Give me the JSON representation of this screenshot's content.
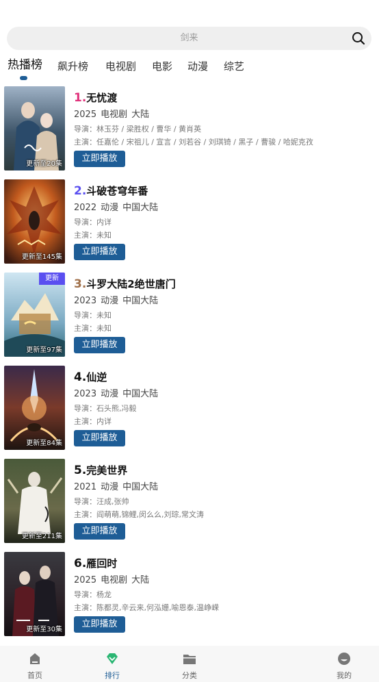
{
  "search": {
    "placeholder": "剑来"
  },
  "tabs": [
    {
      "label": "热播榜",
      "active": true
    },
    {
      "label": "飙升榜"
    },
    {
      "label": "电视剧"
    },
    {
      "label": "电影"
    },
    {
      "label": "动漫"
    },
    {
      "label": "综艺"
    }
  ],
  "colors": {
    "accent": "#1e5d96",
    "rank1": "#e0307a",
    "rank2": "#5a4ff0",
    "rank3": "#a0704a",
    "rankOther": "#111111",
    "newBadge": "#5a4ff0"
  },
  "items": [
    {
      "rank": "1.",
      "title": "无忧渡",
      "year": "2025",
      "type": "电视剧",
      "region": "大陆",
      "director": "导演：林玉芬 / 梁胜权 / 曹华 / 黄肖英",
      "cast": "主演：任嘉伦 / 宋祖儿 / 宣言 / 刘若谷 / 刘琪锜 / 黑子 / 曹骏 / 哈妮克孜",
      "badge": "更新至20集",
      "play": "立即播放"
    },
    {
      "rank": "2.",
      "title": "斗破苍穹年番",
      "year": "2022",
      "type": "动漫",
      "region": "中国大陆",
      "director": "导演：内详",
      "cast": "主演：未知",
      "badge": "更新至145集",
      "play": "立即播放"
    },
    {
      "rank": "3.",
      "title": "斗罗大陆2绝世唐门",
      "year": "2023",
      "type": "动漫",
      "region": "中国大陆",
      "director": "导演：未知",
      "cast": "主演：未知",
      "badge": "更新至97集",
      "new_label": "更新",
      "play": "立即播放"
    },
    {
      "rank": "4.",
      "title": "仙逆",
      "year": "2023",
      "type": "动漫",
      "region": "中国大陆",
      "director": "导演：石头熊,冯毅",
      "cast": "主演：内详",
      "badge": "更新至84集",
      "play": "立即播放"
    },
    {
      "rank": "5.",
      "title": "完美世界",
      "year": "2021",
      "type": "动漫",
      "region": "中国大陆",
      "director": "导演：汪成,张帅",
      "cast": "主演：阎萌萌,锦鲤,闵么么,刘琮,常文涛",
      "badge": "更新至211集",
      "play": "立即播放"
    },
    {
      "rank": "6.",
      "title": "雁回时",
      "year": "2025",
      "type": "电视剧",
      "region": "大陆",
      "director": "导演：杨龙",
      "cast": "主演：陈都灵,辛云来,何泓姗,喻恩泰,温峥嵘",
      "badge": "更新至30集",
      "play": "立即播放"
    }
  ],
  "nav": [
    {
      "label": "首页",
      "icon": "home-icon"
    },
    {
      "label": "排行",
      "icon": "ranking-icon",
      "active": true
    },
    {
      "label": "分类",
      "icon": "folder-icon"
    },
    {
      "label": "我的",
      "icon": "profile-icon"
    }
  ]
}
